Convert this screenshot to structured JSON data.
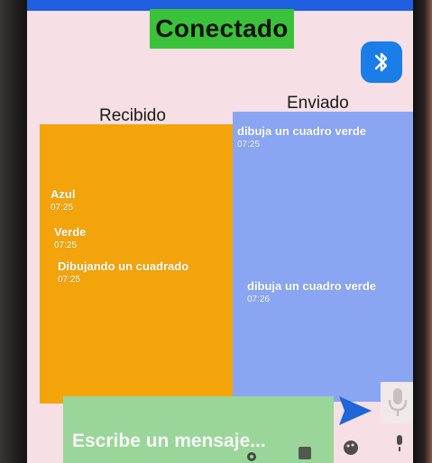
{
  "connection": {
    "status_label": "Conectado"
  },
  "columns": {
    "received_title": "Recibido",
    "sent_title": "Enviado"
  },
  "received_messages": [
    {
      "text": "Azul",
      "time": "07:25"
    },
    {
      "text": "Verde",
      "time": "07:25"
    },
    {
      "text": "Dibujando un cuadrado",
      "time": "07:25"
    }
  ],
  "sent_messages": [
    {
      "text": "dibuja un cuadro verde",
      "time": "07:25"
    },
    {
      "text": "dibuja un cuadro verde",
      "time": "07:26"
    }
  ],
  "composer": {
    "placeholder": "Escribe un mensaje..."
  },
  "icons": {
    "bluetooth": "bluetooth-icon",
    "send": "send-icon",
    "microphone": "microphone-icon"
  },
  "colors": {
    "status_green": "#39c23a",
    "received_bg": "#f2a40a",
    "sent_bg": "#8aa6f2",
    "composer_bg": "#9ad69a",
    "bluetooth_blue": "#1a7de8",
    "app_bg": "#f6dfe5"
  }
}
